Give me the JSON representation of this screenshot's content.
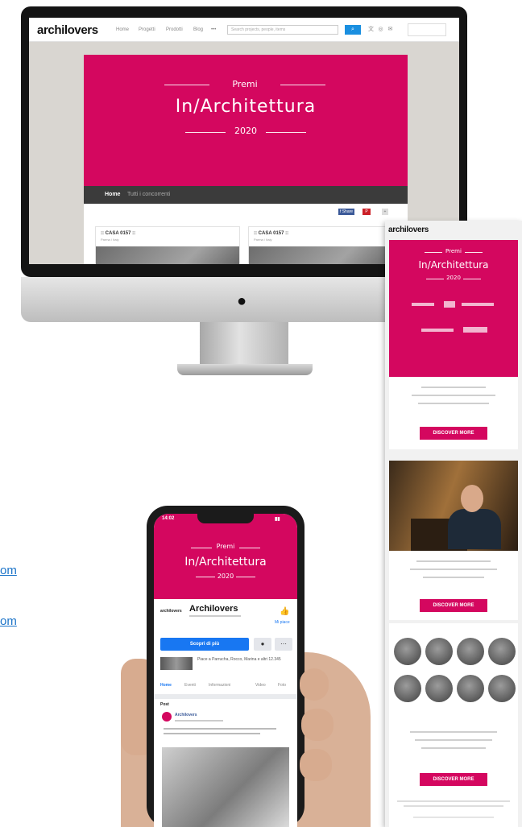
{
  "brand": {
    "pink": "#d4075f",
    "dark": "#3b3b3b",
    "link_blue": "#1a73c8",
    "fb_blue": "#1877f2"
  },
  "desktop": {
    "logo": "archilovers",
    "nav": [
      "Home",
      "Progetti",
      "Prodotti",
      "Blog",
      "•••"
    ],
    "search_placeholder": "Search projects, people, items",
    "hero": {
      "title_top": "Premi",
      "title_main": "In/Architettura",
      "year": "2020"
    },
    "breadcrumb": {
      "home": "Home",
      "rest": "Tutti i concorrenti"
    },
    "share_labels": [
      "f Share",
      "P"
    ],
    "cards": [
      {
        "title": ":: CASA 0157 ::",
        "location": "Parma / Italy"
      },
      {
        "title": ":: CASA 0157 ::",
        "location": "Parma / Italy"
      }
    ]
  },
  "newsletter": {
    "logo": "archilovers",
    "hero": {
      "title_top": "Premi",
      "title_main": "In/Architettura",
      "year": "2020"
    },
    "cta_labels": [
      "DISCOVER MORE",
      "DISCOVER MORE",
      "DISCOVER MORE"
    ]
  },
  "links": {
    "items": [
      "om",
      "om"
    ]
  },
  "phone": {
    "time": "14:02",
    "hero": {
      "title_top": "Premi",
      "title_main": "In/Architettura",
      "year": "2020"
    },
    "page_name": "Archilovers",
    "page_logo": "archilovers",
    "like_label": "Mi piace",
    "primary_button": "Scopri di più",
    "tabs": [
      "Home",
      "Eventi",
      "Informazioni",
      "Video",
      "Foto"
    ],
    "post_section": "Post",
    "post_author": "Archilovers",
    "friends_text": "Piace a Parrucha, Rocco, Marina e altri 12.345"
  }
}
